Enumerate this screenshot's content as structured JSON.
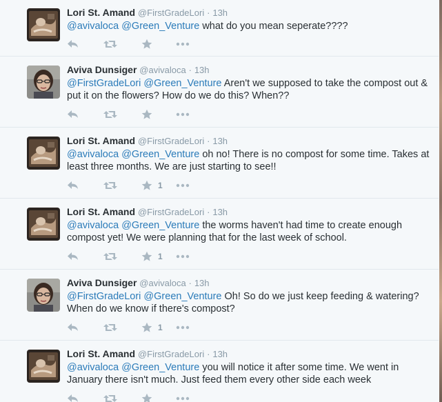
{
  "tweets": [
    {
      "name": "Lori St. Amand",
      "handle": "@FirstGradeLori",
      "sep": "·",
      "time": "13h",
      "mention1": "@avivaloca",
      "mention2": "@Green_Venture",
      "body": "what do you mean seperate????",
      "fav_count": "",
      "avatar": "lori"
    },
    {
      "name": "Aviva Dunsiger",
      "handle": "@avivaloca",
      "sep": "·",
      "time": "13h",
      "mention1": "@FirstGradeLori",
      "mention2": "@Green_Venture",
      "body": "Aren't we supposed to take the compost out & put it on the flowers? How do we do this? When??",
      "fav_count": "",
      "avatar": "aviva"
    },
    {
      "name": "Lori St. Amand",
      "handle": "@FirstGradeLori",
      "sep": "·",
      "time": "13h",
      "mention1": "@avivaloca",
      "mention2": "@Green_Venture",
      "body": "oh no! There is no compost for some time. Takes at least three months. We are just starting to see!!",
      "fav_count": "1",
      "avatar": "lori"
    },
    {
      "name": "Lori St. Amand",
      "handle": "@FirstGradeLori",
      "sep": "·",
      "time": "13h",
      "mention1": "@avivaloca",
      "mention2": "@Green_Venture",
      "body": "the worms haven't had time to create enough compost yet! We were planning that for the last week of school.",
      "fav_count": "1",
      "avatar": "lori"
    },
    {
      "name": "Aviva Dunsiger",
      "handle": "@avivaloca",
      "sep": "·",
      "time": "13h",
      "mention1": "@FirstGradeLori",
      "mention2": "@Green_Venture",
      "body": "Oh! So do we just keep feeding & watering? When do we know if there's compost?",
      "fav_count": "1",
      "avatar": "aviva"
    },
    {
      "name": "Lori St. Amand",
      "handle": "@FirstGradeLori",
      "sep": "·",
      "time": "13h",
      "mention1": "@avivaloca",
      "mention2": "@Green_Venture",
      "body": "you will notice it after some time. We went in January there isn't much. Just feed them every other side each week",
      "fav_count": "",
      "avatar": "lori"
    }
  ],
  "icons": {
    "reply": "reply-icon",
    "retweet": "retweet-icon",
    "favorite": "star-icon",
    "more": "more-icon"
  },
  "colors": {
    "background": "#f5f8fa",
    "link": "#2b7bb9",
    "text": "#292f33",
    "muted": "#8899a6",
    "icon": "#aab8c2",
    "divider": "#e1e8ed"
  }
}
